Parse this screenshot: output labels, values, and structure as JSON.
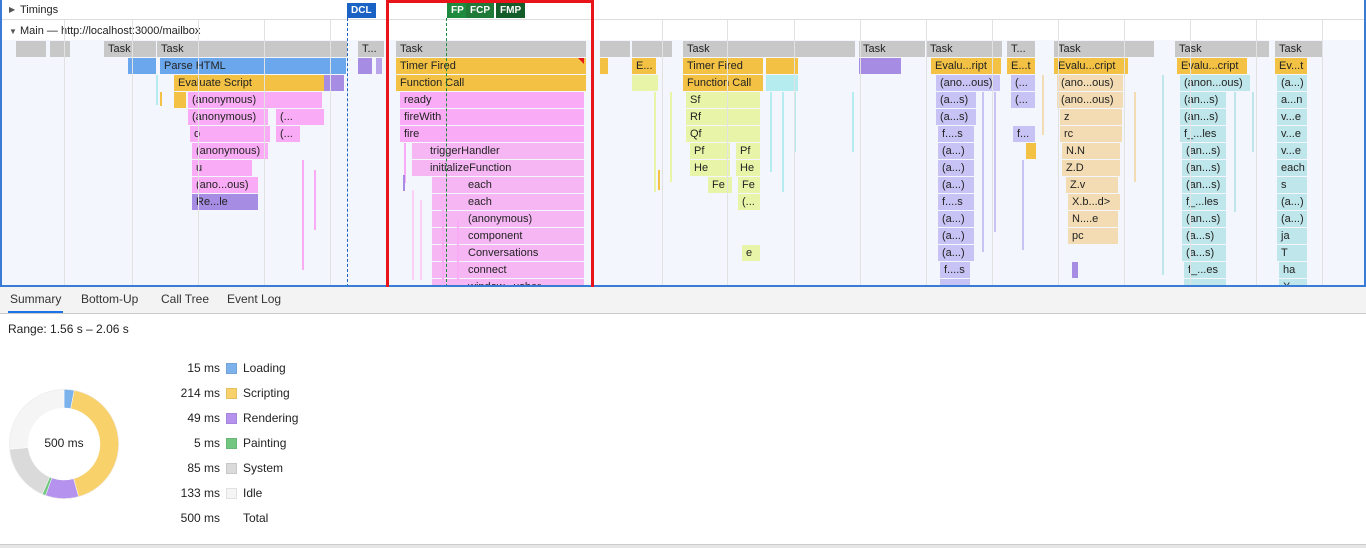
{
  "header": {
    "timings_label": "Timings",
    "main_label": "Main — http://localhost:3000/mailbox"
  },
  "markers": {
    "dcl": "DCL",
    "fp": "FP",
    "fcp": "FCP",
    "fmp": "FMP"
  },
  "flame": {
    "task_label": "Task",
    "task_short": "T...",
    "parse_html": "Parse HTML",
    "evaluate_script": "Evaluate Script",
    "anonymous": "(anonymous)",
    "anon_ellipsis": "(...",
    "o": "o",
    "u": "u",
    "anoous": "(ano...ous)",
    "anon_ous": "(anon...ous)",
    "rele": "Re...le",
    "timer_fired": "Timer Fired",
    "function_call": "Function Call",
    "ready": "ready",
    "firewith": "fireWith",
    "fire": "fire",
    "triggerhandler": "triggerHandler",
    "initializefunction": "initializeFunction",
    "each": "each",
    "component": "component",
    "conversations": "Conversations",
    "connect": "connect",
    "windowusher": "window...usher",
    "e_dots": "E...",
    "sf": "Sf",
    "rf": "Rf",
    "qf": "Qf",
    "pf": "Pf",
    "he": "He",
    "fe": "Fe",
    "e": "e",
    "evalu_ript": "Evalu...ript",
    "evalu_cript": "Evalu...cript",
    "e_t": "E...t",
    "ev_t": "Ev...t",
    "a_s": "(a...s)",
    "an_s": "(an...s)",
    "a_dots": "(a...)",
    "f_s": "f....s",
    "f_les": "f_...les",
    "f_es": "f_...es",
    "f_dots": "f...",
    "z": "z",
    "rc": "rc",
    "nn": "N.N",
    "zd": "Z.D",
    "zv": "Z.v",
    "xbd": "X.b...d>",
    "n_e": "N....e",
    "pc": "pc",
    "a_n": "a...n",
    "v_e": "v...e",
    "s": "s",
    "ja": "ja",
    "T": "T",
    "ha": "ha",
    "X": "X"
  },
  "tabs": [
    {
      "label": "Summary"
    },
    {
      "label": "Bottom-Up"
    },
    {
      "label": "Call Tree"
    },
    {
      "label": "Event Log"
    }
  ],
  "summary": {
    "range": "Range: 1.56 s – 2.06 s",
    "total_center": "500 ms",
    "categories": [
      {
        "ms": "15 ms",
        "name": "Loading",
        "value": 15,
        "color": "#7cb2ec"
      },
      {
        "ms": "214 ms",
        "name": "Scripting",
        "value": 214,
        "color": "#f8d16a"
      },
      {
        "ms": "49 ms",
        "name": "Rendering",
        "value": 49,
        "color": "#b592ed"
      },
      {
        "ms": "5 ms",
        "name": "Painting",
        "value": 5,
        "color": "#72c780"
      },
      {
        "ms": "85 ms",
        "name": "System",
        "value": 85,
        "color": "#dadada"
      },
      {
        "ms": "133 ms",
        "name": "Idle",
        "value": 133,
        "color": "#f5f5f5"
      }
    ],
    "total_ms": "500 ms",
    "total_label": "Total"
  }
}
